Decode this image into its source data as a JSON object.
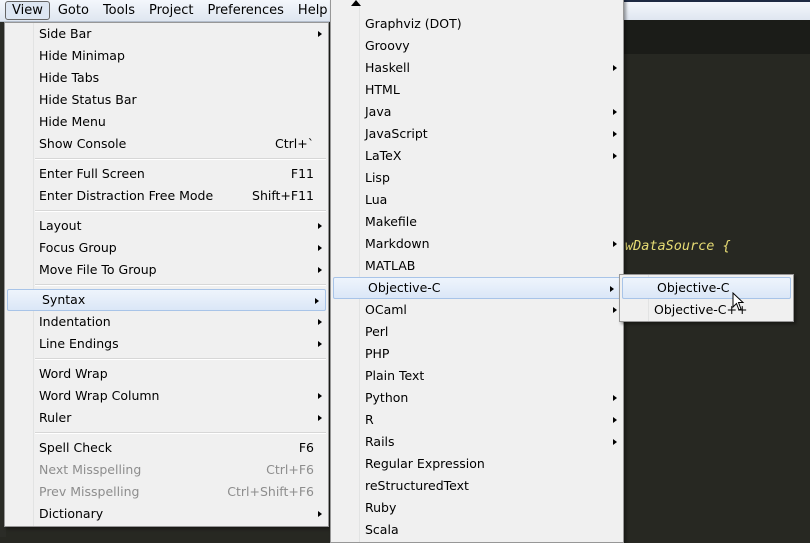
{
  "menubar": [
    {
      "label": "View",
      "active": true
    },
    {
      "label": "Goto"
    },
    {
      "label": "Tools"
    },
    {
      "label": "Project"
    },
    {
      "label": "Preferences"
    },
    {
      "label": "Help"
    }
  ],
  "view_menu": [
    {
      "label": "Side Bar",
      "sub": true
    },
    {
      "label": "Hide Minimap"
    },
    {
      "label": "Hide Tabs"
    },
    {
      "label": "Hide Status Bar"
    },
    {
      "label": "Hide Menu"
    },
    {
      "label": "Show Console",
      "shortcut": "Ctrl+`"
    },
    {
      "sep": true
    },
    {
      "label": "Enter Full Screen",
      "shortcut": "F11"
    },
    {
      "label": "Enter Distraction Free Mode",
      "shortcut": "Shift+F11"
    },
    {
      "sep": true
    },
    {
      "label": "Layout",
      "sub": true
    },
    {
      "label": "Focus Group",
      "sub": true
    },
    {
      "label": "Move File To Group",
      "sub": true
    },
    {
      "sep": true
    },
    {
      "label": "Syntax",
      "sub": true,
      "highlight": true
    },
    {
      "label": "Indentation",
      "sub": true
    },
    {
      "label": "Line Endings",
      "sub": true
    },
    {
      "sep": true
    },
    {
      "label": "Word Wrap"
    },
    {
      "label": "Word Wrap Column",
      "sub": true
    },
    {
      "label": "Ruler",
      "sub": true
    },
    {
      "sep": true
    },
    {
      "label": "Spell Check",
      "shortcut": "F6"
    },
    {
      "label": "Next Misspelling",
      "shortcut": "Ctrl+F6",
      "disabled": true
    },
    {
      "label": "Prev Misspelling",
      "shortcut": "Ctrl+Shift+F6",
      "disabled": true
    },
    {
      "label": "Dictionary",
      "sub": true
    }
  ],
  "syntax_menu": [
    {
      "label": "Graphviz (DOT)"
    },
    {
      "label": "Groovy"
    },
    {
      "label": "Haskell",
      "sub": true
    },
    {
      "label": "HTML"
    },
    {
      "label": "Java",
      "sub": true
    },
    {
      "label": "JavaScript",
      "sub": true
    },
    {
      "label": "LaTeX",
      "sub": true
    },
    {
      "label": "Lisp"
    },
    {
      "label": "Lua"
    },
    {
      "label": "Makefile"
    },
    {
      "label": "Markdown",
      "sub": true
    },
    {
      "label": "MATLAB"
    },
    {
      "label": "Objective-C",
      "sub": true,
      "highlight": true
    },
    {
      "label": "OCaml",
      "sub": true
    },
    {
      "label": "Perl"
    },
    {
      "label": "PHP"
    },
    {
      "label": "Plain Text"
    },
    {
      "label": "Python",
      "sub": true
    },
    {
      "label": "R",
      "sub": true
    },
    {
      "label": "Rails",
      "sub": true
    },
    {
      "label": "Regular Expression"
    },
    {
      "label": "reStructuredText"
    },
    {
      "label": "Ruby"
    },
    {
      "label": "Scala"
    }
  ],
  "objc_menu": [
    {
      "label": "Objective-C",
      "highlight": true
    },
    {
      "label": "Objective-C++"
    }
  ],
  "editor": {
    "code_line": "wDataSource {"
  }
}
